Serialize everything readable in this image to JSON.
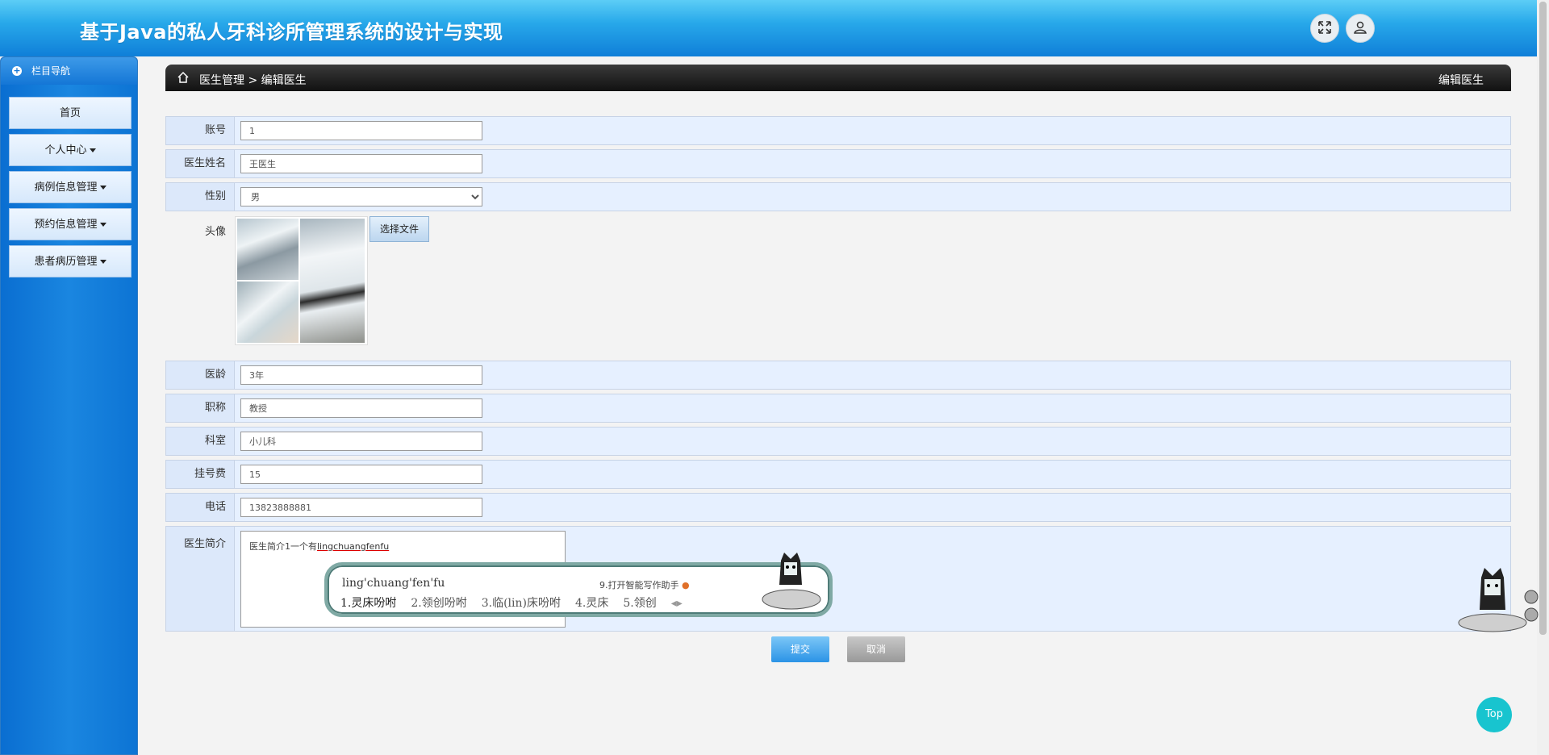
{
  "header": {
    "title": "基于Java的私人牙科诊所管理系统的设计与实现",
    "fullscreen_icon": "expand-icon",
    "user_icon": "user-icon"
  },
  "sidebar": {
    "title": "栏目导航",
    "items": [
      {
        "label": "首页",
        "has_caret": false
      },
      {
        "label": "个人中心",
        "has_caret": true
      },
      {
        "label": "病例信息管理",
        "has_caret": true
      },
      {
        "label": "预约信息管理",
        "has_caret": true
      },
      {
        "label": "患者病历管理",
        "has_caret": true
      }
    ]
  },
  "breadcrumb": {
    "parent": "医生管理",
    "separator": ">",
    "current": "编辑医生",
    "right_title": "编辑医生"
  },
  "form": {
    "account": {
      "label": "账号",
      "value": "1"
    },
    "name": {
      "label": "医生姓名",
      "value": "王医生"
    },
    "gender": {
      "label": "性别",
      "value": "男"
    },
    "avatar": {
      "label": "头像",
      "button": "选择文件"
    },
    "years": {
      "label": "医龄",
      "value": "3年"
    },
    "title": {
      "label": "职称",
      "value": "教授"
    },
    "department": {
      "label": "科室",
      "value": "小儿科"
    },
    "fee": {
      "label": "挂号费",
      "value": "15"
    },
    "phone": {
      "label": "电话",
      "value": "13823888881"
    },
    "intro": {
      "label": "医生简介",
      "text": "医生简介1一个有",
      "composing": "lingchuangfenfu"
    }
  },
  "actions": {
    "submit": "提交",
    "cancel": "取消"
  },
  "ime": {
    "pinyin": "ling'chuang'fen'fu",
    "assistant": "9.打开智能写作助手",
    "candidates": [
      "1.灵床吩咐",
      "2.领创吩咐",
      "3.临(lin)床吩咐",
      "4.灵床",
      "5.领创"
    ]
  },
  "top_button": "Top"
}
